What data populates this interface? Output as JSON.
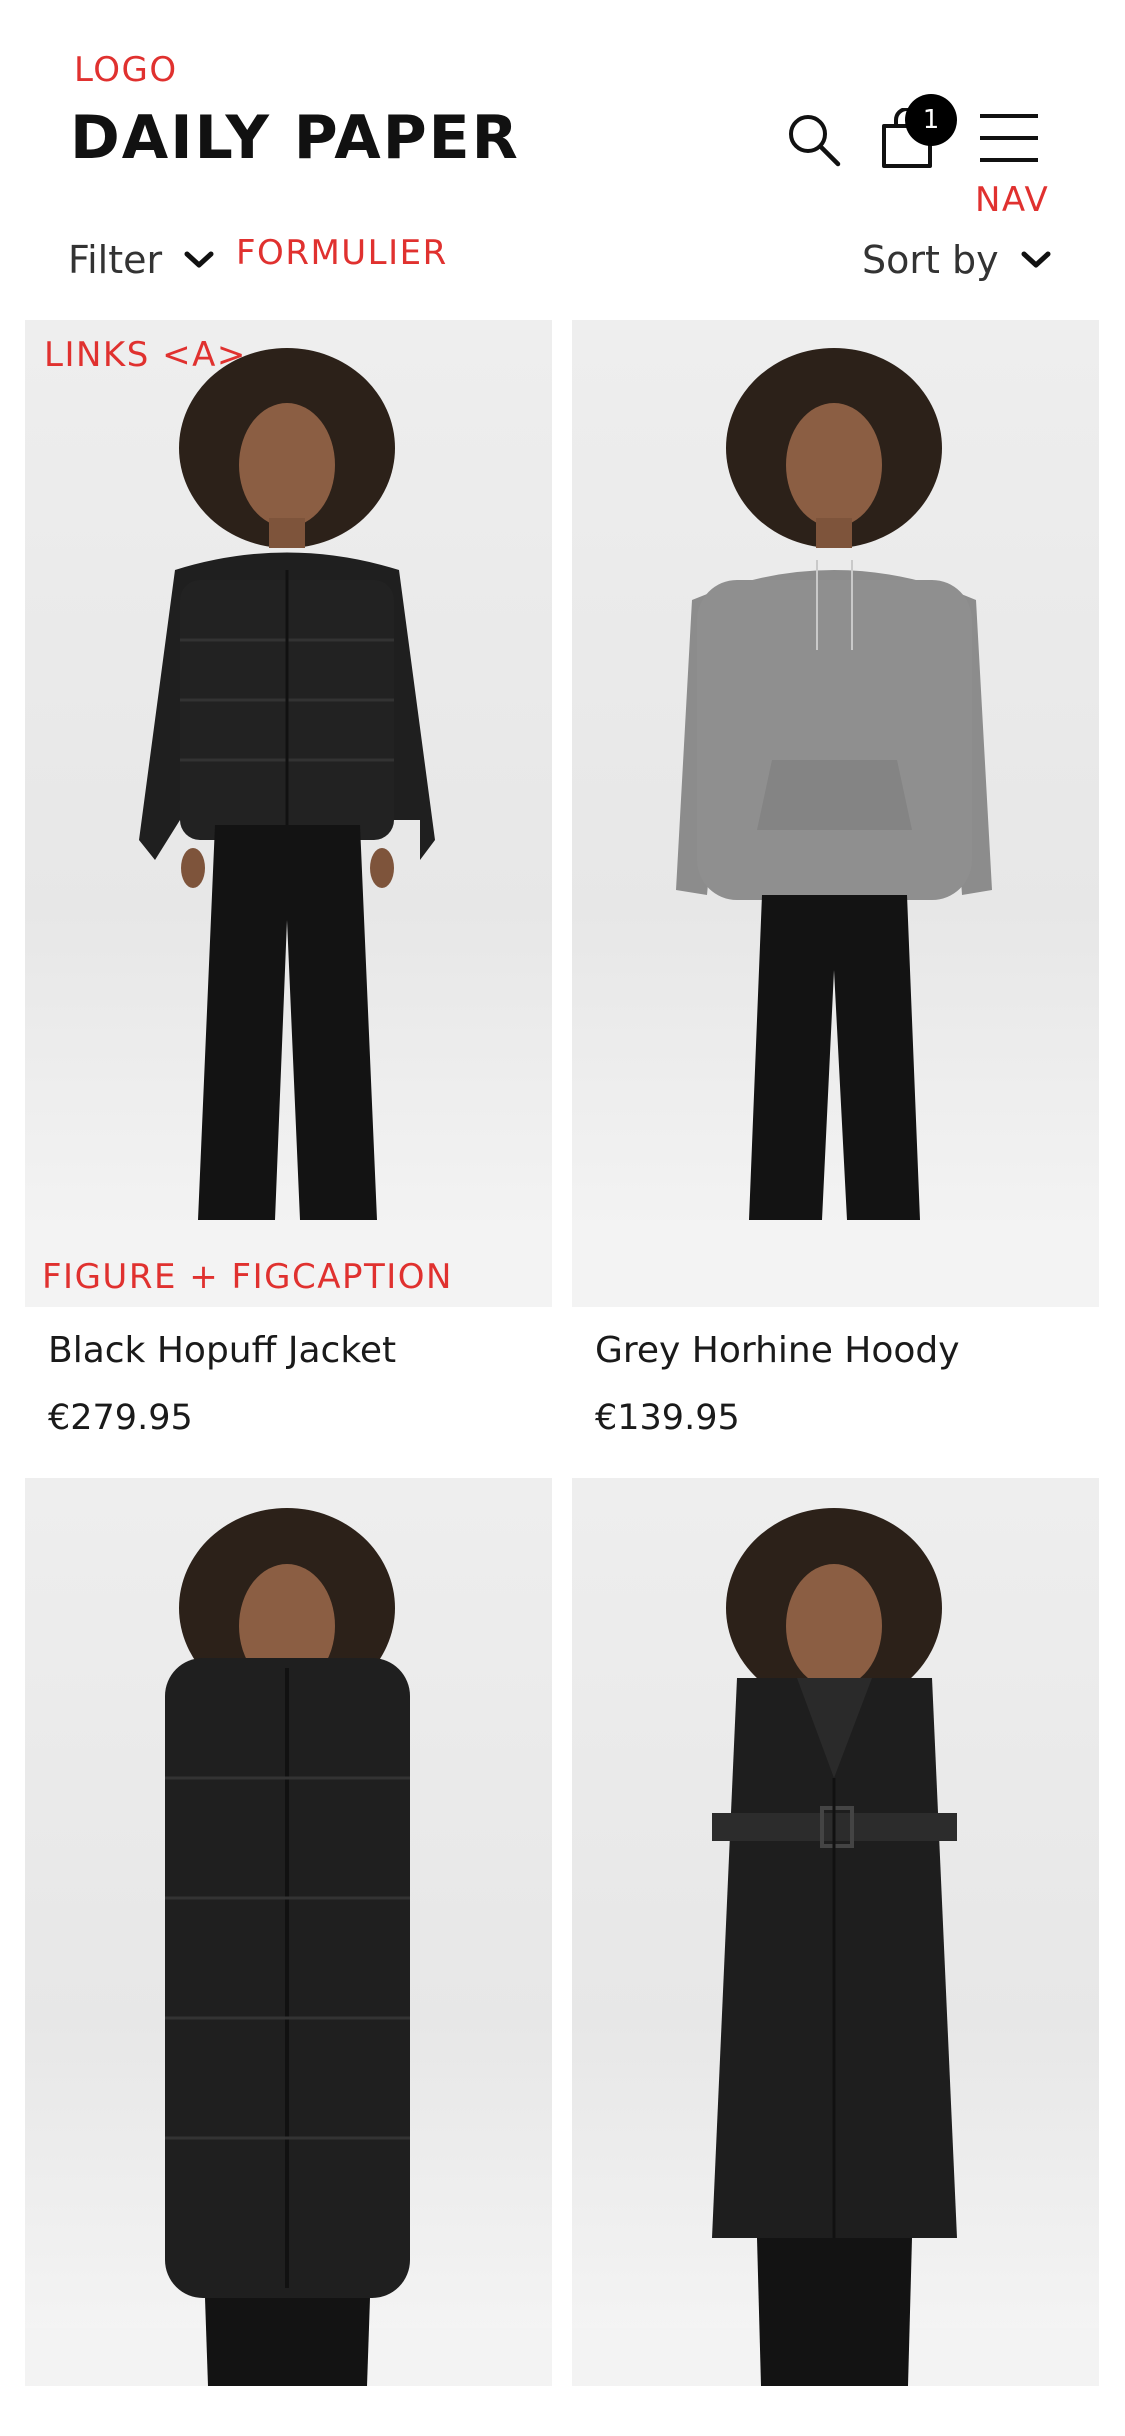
{
  "annotations": {
    "logo": "LOGO",
    "nav": "NAV",
    "form": "FORMULIER",
    "links": "LINKS <A>",
    "figure": "FIGURE + FIGCAPTION"
  },
  "header": {
    "logo": "DAILY PAPER",
    "cart_count": "1",
    "icons": [
      "search-icon",
      "shopping-bag-icon",
      "hamburger-menu-icon"
    ]
  },
  "toolbar": {
    "filter_label": "Filter",
    "sort_label": "Sort by",
    "chevron_icon": "chevron-down-icon"
  },
  "products": [
    {
      "name": "Black Hopuff Jacket",
      "price": "€279.95",
      "garment": "short-black-puffer"
    },
    {
      "name": "Grey Horhine Hoody",
      "price": "€139.95",
      "garment": "grey-hoodie"
    },
    {
      "name": "",
      "price": "",
      "garment": "long-black-puffer"
    },
    {
      "name": "",
      "price": "",
      "garment": "black-trench-coat"
    }
  ],
  "colors": {
    "annotation": "#e0312f",
    "text": "#1a1a1a",
    "photo_bg": "#e9e9e9",
    "badge": "#000000"
  }
}
